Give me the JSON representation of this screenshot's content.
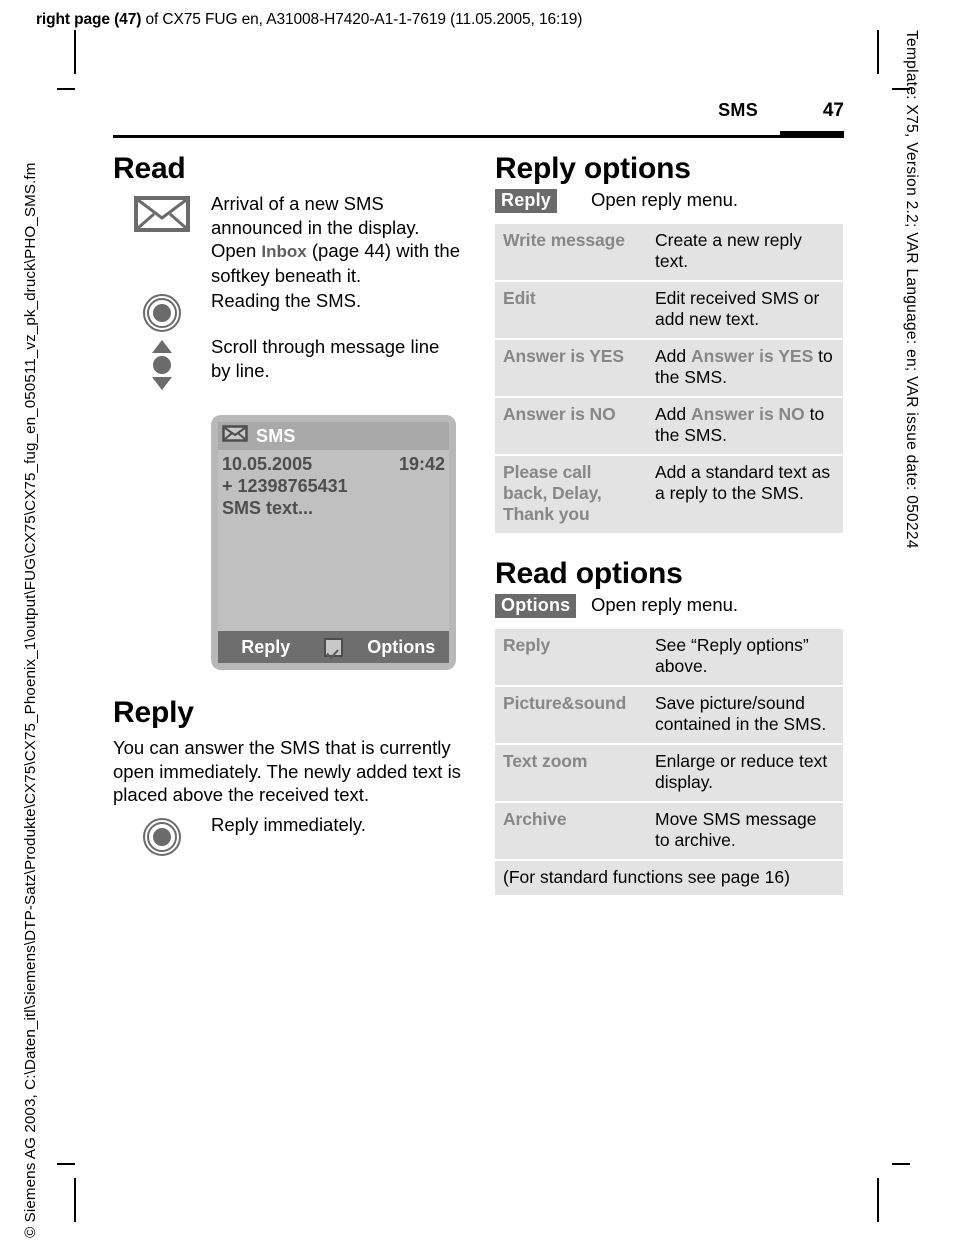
{
  "print_marks": {
    "job_line_bold": "right page (47)",
    "job_line_rest": " of CX75 FUG en, A31008-H7420-A1-1-7619 (11.05.2005, 16:19)",
    "margin_right": "Template: X75, Version 2.2; VAR Language: en; VAR issue date: 050224",
    "margin_left": "© Siemens AG 2003, C:\\Daten_itl\\Siemens\\DTP-Satz\\Produkte\\CX75\\CX75_Phoenix_1\\output\\FUG\\CX75\\CX75_fug_en_050511_vz_pk_druck\\PHO_SMS.fm"
  },
  "header": {
    "chapter": "SMS",
    "page_number": "47"
  },
  "left_column": {
    "read_heading": "Read",
    "key_rows": [
      {
        "icon": "envelope-icon",
        "text_before": "Arrival of a new SMS announced in the display. Open ",
        "screen_key": "Inbox",
        "text_after": " (page 44) with the softkey beneath it."
      },
      {
        "icon": "joystick-press-icon",
        "text": "Reading the SMS."
      },
      {
        "icon": "joystick-scroll-icon",
        "text": "Scroll through message line by line."
      }
    ],
    "phone_display": {
      "title": "SMS",
      "title_icon": "envelope-icon",
      "date": "10.05.2005",
      "time": "19:42",
      "sender": "+ 12398765431",
      "body": "SMS text...",
      "softkey_left": "Reply",
      "softkey_center_icon": "checkbox-checked-icon",
      "softkey_right": "Options"
    },
    "reply_heading": "Reply",
    "reply_paragraph": "You can answer the SMS that is currently open immediately. The newly added text is placed above the received text.",
    "reply_key_row": {
      "icon": "joystick-press-icon",
      "text": "Reply immediately."
    }
  },
  "right_column": {
    "reply_options": {
      "heading": "Reply options",
      "badge": "Reply",
      "badge_description": "Open reply menu.",
      "rows": [
        {
          "key": "Write message",
          "value_parts": [
            {
              "t": "Create a new reply text.",
              "k": false
            }
          ]
        },
        {
          "key": "Edit",
          "value_parts": [
            {
              "t": "Edit received SMS or add new text.",
              "k": false
            }
          ]
        },
        {
          "key": "Answer is YES",
          "value_parts": [
            {
              "t": "Add ",
              "k": false
            },
            {
              "t": "Answer is YES",
              "k": true
            },
            {
              "t": " to the SMS.",
              "k": false
            }
          ]
        },
        {
          "key": "Answer is NO",
          "value_parts": [
            {
              "t": "Add ",
              "k": false
            },
            {
              "t": "Answer is NO",
              "k": true
            },
            {
              "t": " to the SMS.",
              "k": false
            }
          ]
        },
        {
          "key": "Please call back, Delay, Thank you",
          "value_parts": [
            {
              "t": "Add a standard text as a reply to the SMS.",
              "k": false
            }
          ]
        }
      ]
    },
    "read_options": {
      "heading": "Read options",
      "badge": "Options",
      "badge_description": "Open reply menu.",
      "rows": [
        {
          "key": "Reply",
          "value_parts": [
            {
              "t": "See “Reply options” above.",
              "k": false
            }
          ]
        },
        {
          "key": "Picture&sound",
          "value_parts": [
            {
              "t": "Save picture/sound contained in the SMS.",
              "k": false
            }
          ]
        },
        {
          "key": "Text zoom",
          "value_parts": [
            {
              "t": "Enlarge or reduce text display.",
              "k": false
            }
          ]
        },
        {
          "key": "Archive",
          "value_parts": [
            {
              "t": "Move SMS message to archive.",
              "k": false
            }
          ]
        }
      ],
      "footnote": "(For standard functions see page 16)"
    }
  },
  "colors": {
    "table_row_bg": "#e3e3e3",
    "key_grey": "#878787",
    "badge_bg": "#6b6b6b",
    "phone_bezel": "#b8b8b8",
    "phone_screen": "#c0c0c0",
    "phone_titlebar": "#a9a9a9",
    "phone_softbar": "#6e6e6e"
  }
}
